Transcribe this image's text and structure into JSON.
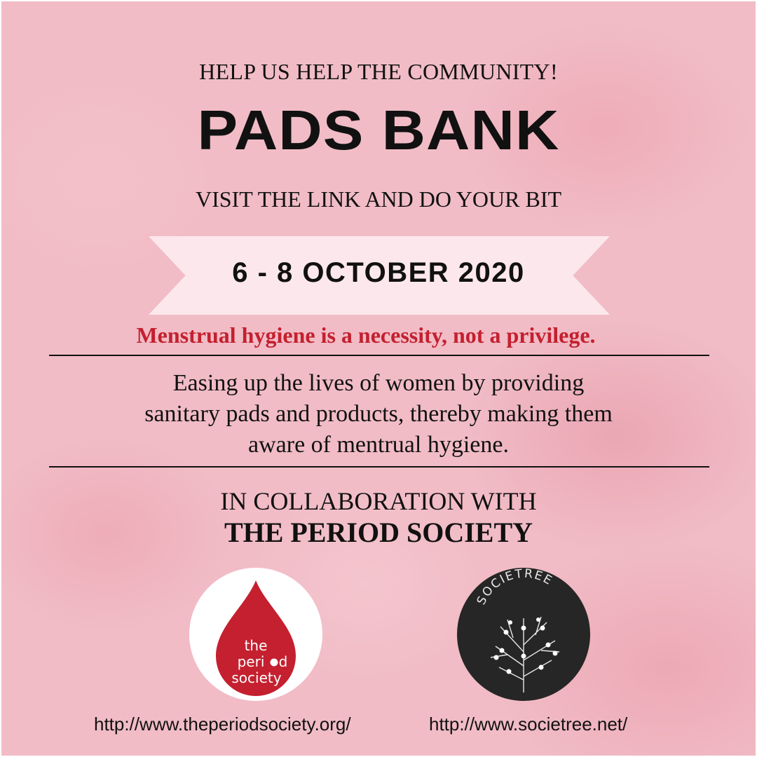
{
  "header": {
    "kicker": "HELP US HELP THE COMMUNITY!",
    "headline": "PADS BANK",
    "subheadline": "VISIT THE LINK AND DO YOUR BIT"
  },
  "event": {
    "date": "6 - 8 OCTOBER 2020"
  },
  "tagline": "Menstrual hygiene is a necessity, not a privilege.",
  "description": {
    "line1": "Easing up the lives of women by providing",
    "line2": "sanitary pads and products, thereby making them",
    "line3": "aware of mentrual hygiene."
  },
  "collaboration": {
    "intro": "IN COLLABORATION WITH",
    "partner": "THE PERIOD SOCIETY"
  },
  "logos": {
    "period_society": {
      "line1": "the",
      "line2": "peri",
      "line2_tail": "d",
      "line3": "society",
      "color": "#c4202f"
    },
    "societree": {
      "word": "SOCIETREE"
    }
  },
  "links": {
    "period_society": "http://www.theperiodsociety.org/",
    "societree": "http://www.societree.net/"
  },
  "colors": {
    "background": "#f1bcc6",
    "accent": "#c4202f",
    "ribbon": "#fce8ec"
  }
}
